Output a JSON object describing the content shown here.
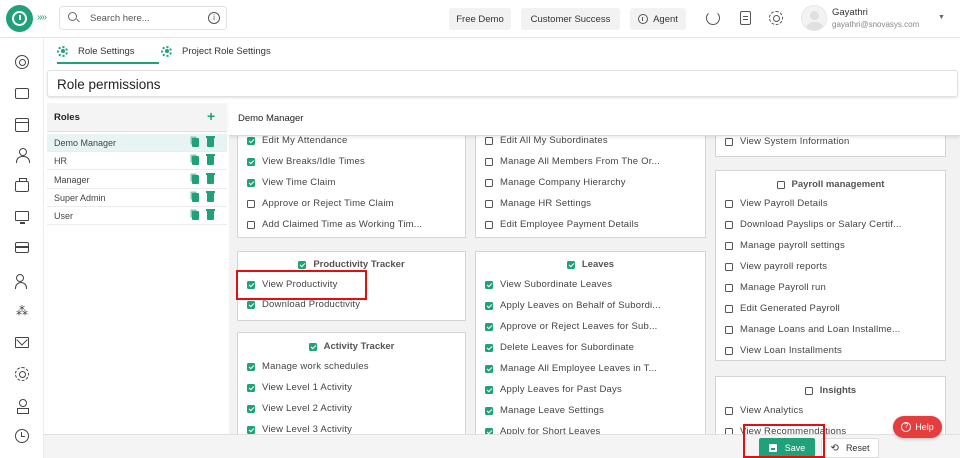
{
  "topbar": {
    "search_placeholder": "Search here...",
    "free_demo": "Free Demo",
    "customer_success": "Customer Success",
    "agent": "Agent",
    "user_name": "Gayathri",
    "user_email": "gayathri@snovasys.com"
  },
  "tabs": [
    {
      "label": "Role Settings"
    },
    {
      "label": "Project Role Settings"
    }
  ],
  "page_title": "Role permissions",
  "roles": {
    "header": "Roles",
    "add": "+",
    "items": [
      {
        "name": "Demo Manager"
      },
      {
        "name": "HR"
      },
      {
        "name": "Manager"
      },
      {
        "name": "Super Admin"
      },
      {
        "name": "User"
      }
    ]
  },
  "selected_role": "Demo Manager",
  "cards": {
    "c1_items": [
      {
        "label": "Edit My Attendance",
        "checked": true
      },
      {
        "label": "View Breaks/Idle Times",
        "checked": true
      },
      {
        "label": "View Time Claim",
        "checked": true
      },
      {
        "label": "Approve or Reject Time Claim",
        "checked": false
      },
      {
        "label": "Add Claimed Time as Working Tim...",
        "checked": false
      }
    ],
    "productivity": {
      "title": "Productivity Tracker",
      "items": [
        {
          "label": "View Productivity",
          "checked": true
        },
        {
          "label": "Download Productivity",
          "checked": true
        }
      ]
    },
    "activity": {
      "title": "Activity Tracker",
      "items": [
        {
          "label": "Manage work schedules",
          "checked": true
        },
        {
          "label": "View Level 1 Activity",
          "checked": true
        },
        {
          "label": "View Level 2 Activity",
          "checked": true
        },
        {
          "label": "View Level 3 Activity",
          "checked": true
        }
      ]
    },
    "c2_items": [
      {
        "label": "Edit All My Subordinates",
        "checked": false
      },
      {
        "label": "Manage All Members From The Or...",
        "checked": false
      },
      {
        "label": "Manage Company Hierarchy",
        "checked": false
      },
      {
        "label": "Manage HR Settings",
        "checked": false
      },
      {
        "label": "Edit Employee Payment Details",
        "checked": false
      }
    ],
    "leaves": {
      "title": "Leaves",
      "items": [
        {
          "label": "View Subordinate Leaves",
          "checked": true
        },
        {
          "label": "Apply Leaves on Behalf of Subordi...",
          "checked": true
        },
        {
          "label": "Approve or Reject Leaves for Sub...",
          "checked": true
        },
        {
          "label": "Delete Leaves for Subordinate",
          "checked": true
        },
        {
          "label": "Manage All Employee Leaves in T...",
          "checked": true
        },
        {
          "label": "Apply Leaves for Past Days",
          "checked": true
        },
        {
          "label": "Manage Leave Settings",
          "checked": true
        },
        {
          "label": "Apply for Short Leaves",
          "checked": true
        }
      ]
    },
    "c3_items": [
      {
        "label": "View System Information",
        "checked": false
      }
    ],
    "payroll": {
      "title": "Payroll management",
      "items": [
        {
          "label": "View Payroll Details",
          "checked": false
        },
        {
          "label": "Download Payslips or Salary Certif...",
          "checked": false
        },
        {
          "label": "Manage payroll settings",
          "checked": false
        },
        {
          "label": "View payroll reports",
          "checked": false
        },
        {
          "label": "Manage Payroll run",
          "checked": false
        },
        {
          "label": "Edit Generated Payroll",
          "checked": false
        },
        {
          "label": "Manage Loans and Loan Installme...",
          "checked": false
        },
        {
          "label": "View Loan Installments",
          "checked": false
        }
      ]
    },
    "insights": {
      "title": "Insights",
      "items": [
        {
          "label": "View Analytics",
          "checked": false
        },
        {
          "label": "View Recommendations",
          "checked": false
        }
      ]
    }
  },
  "actions": {
    "save": "Save",
    "reset": "Reset",
    "help": "Help"
  },
  "colors": {
    "accent": "#21a179",
    "highlight": "#e01010",
    "help": "#e43d3d"
  }
}
